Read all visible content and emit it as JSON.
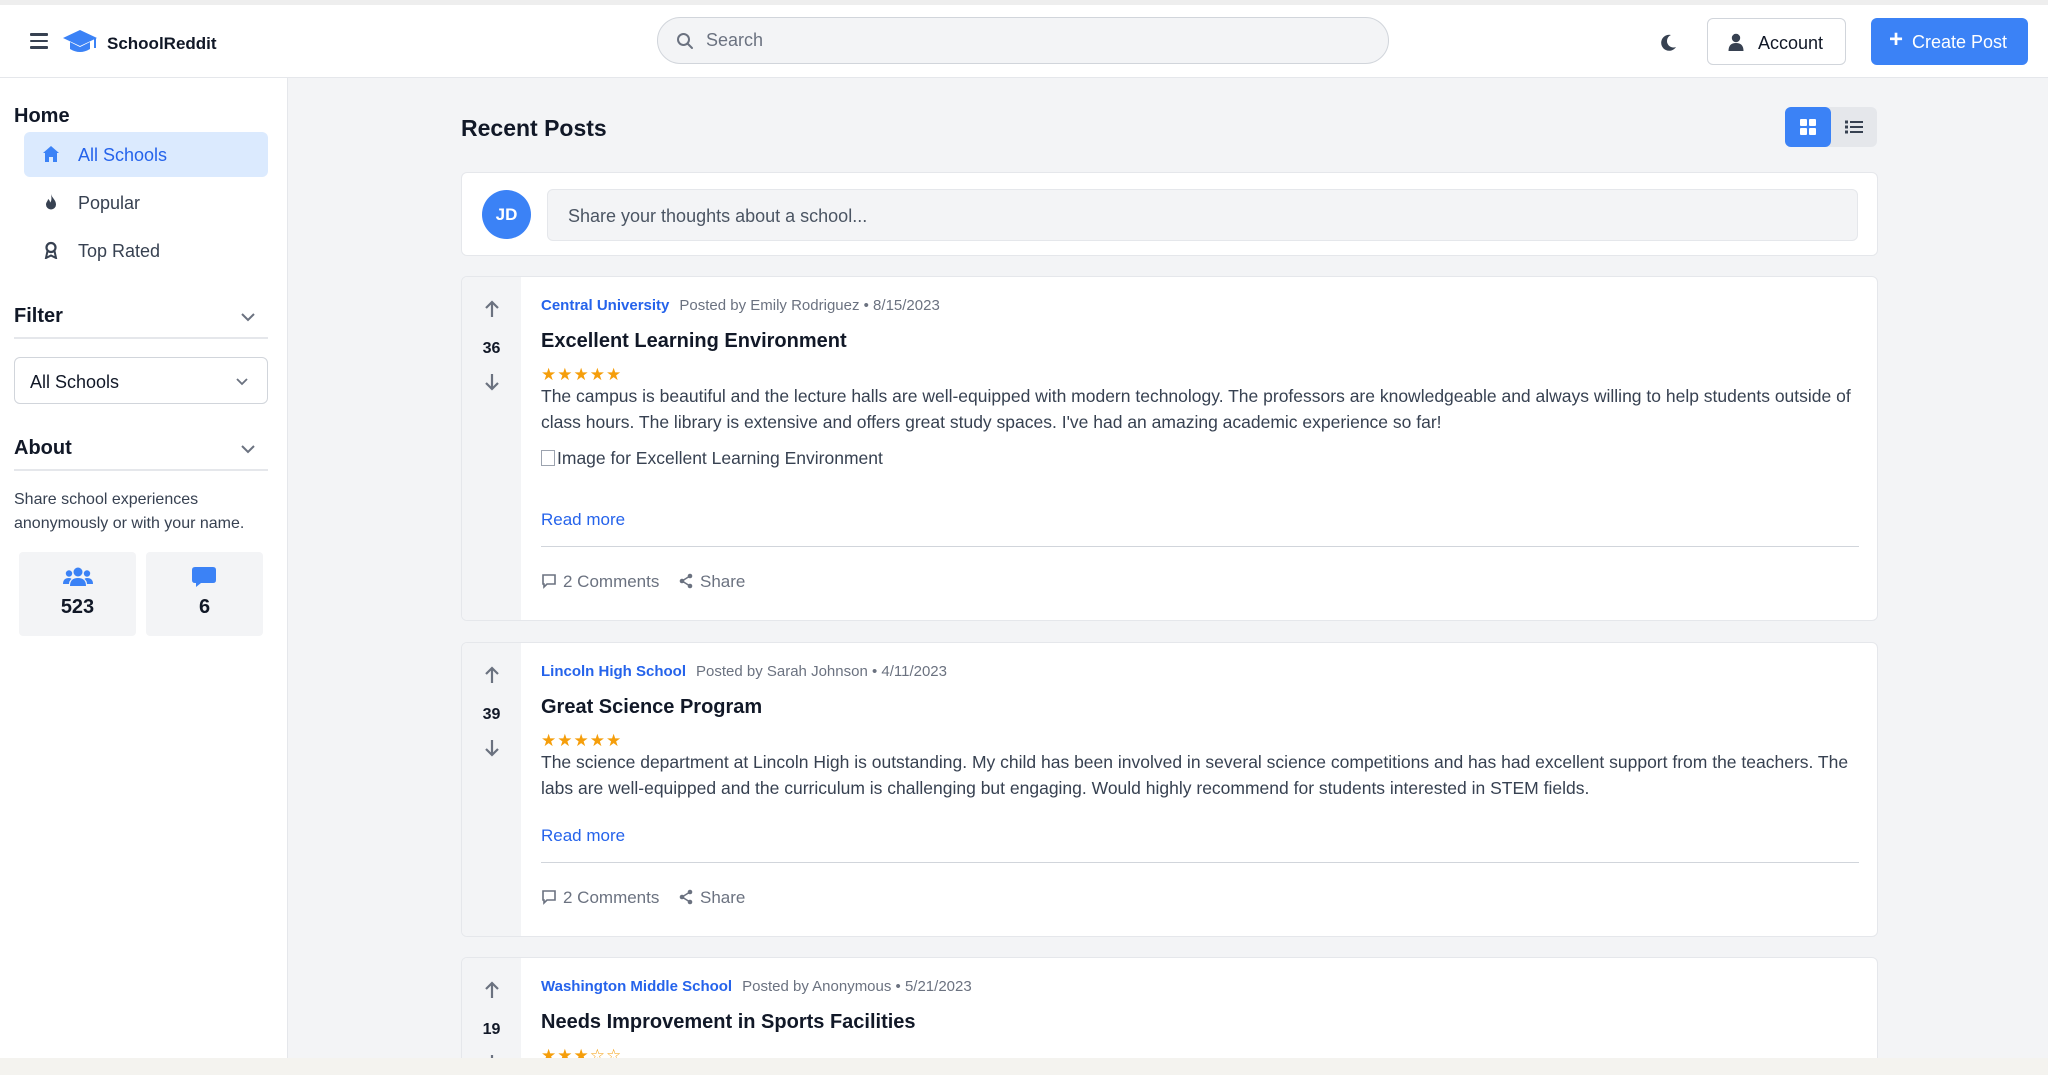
{
  "header": {
    "brand": "SchoolReddit",
    "search_placeholder": "Search",
    "account_label": "Account",
    "create_post_label": "Create Post"
  },
  "colors": {
    "primary": "#3b82f6",
    "link": "#2563eb",
    "star": "#f59e0b",
    "active_nav_bg": "#dbeafe"
  },
  "sidebar": {
    "home_heading": "Home",
    "nav_items": [
      {
        "label": "All Schools",
        "icon": "home-icon",
        "active": true
      },
      {
        "label": "Popular",
        "icon": "fire-icon",
        "active": false
      },
      {
        "label": "Top Rated",
        "icon": "award-icon",
        "active": false
      }
    ],
    "filter_heading": "Filter",
    "filter_selected": "All Schools",
    "about_heading": "About",
    "about_text": "Share school experiences anonymously or with your name.",
    "stats": [
      {
        "icon": "users-icon",
        "value": "523"
      },
      {
        "icon": "comment-icon",
        "value": "6"
      }
    ]
  },
  "main": {
    "title": "Recent Posts",
    "view_modes": [
      {
        "icon": "grid-icon",
        "active": true
      },
      {
        "icon": "list-icon",
        "active": false
      }
    ],
    "composer": {
      "avatar_initials": "JD",
      "placeholder": "Share your thoughts about a school..."
    },
    "posts": [
      {
        "votes": "36",
        "school": "Central University",
        "meta": "Posted by Emily Rodriguez • 8/15/2023",
        "title": "Excellent Learning Environment",
        "rating": 5,
        "stars": "★★★★★",
        "body": "The campus is beautiful and the lecture halls are well-equipped with modern technology. The professors are knowledgeable and always willing to help students outside of class hours. The library is extensive and offers great study spaces. I've had an amazing academic experience so far!",
        "image_alt": "Image for Excellent Learning Environment",
        "read_more": "Read more",
        "comments": "2 Comments",
        "share": "Share"
      },
      {
        "votes": "39",
        "school": "Lincoln High School",
        "meta": "Posted by Sarah Johnson • 4/11/2023",
        "title": "Great Science Program",
        "rating": 5,
        "stars": "★★★★★",
        "body": "The science department at Lincoln High is outstanding. My child has been involved in several science competitions and has had excellent support from the teachers. The labs are well-equipped and the curriculum is challenging but engaging. Would highly recommend for students interested in STEM fields.",
        "read_more": "Read more",
        "comments": "2 Comments",
        "share": "Share"
      },
      {
        "votes": "19",
        "school": "Washington Middle School",
        "meta": "Posted by Anonymous • 5/21/2023",
        "title": "Needs Improvement in Sports Facilities",
        "rating": 3,
        "stars": "★★★☆☆"
      }
    ]
  }
}
